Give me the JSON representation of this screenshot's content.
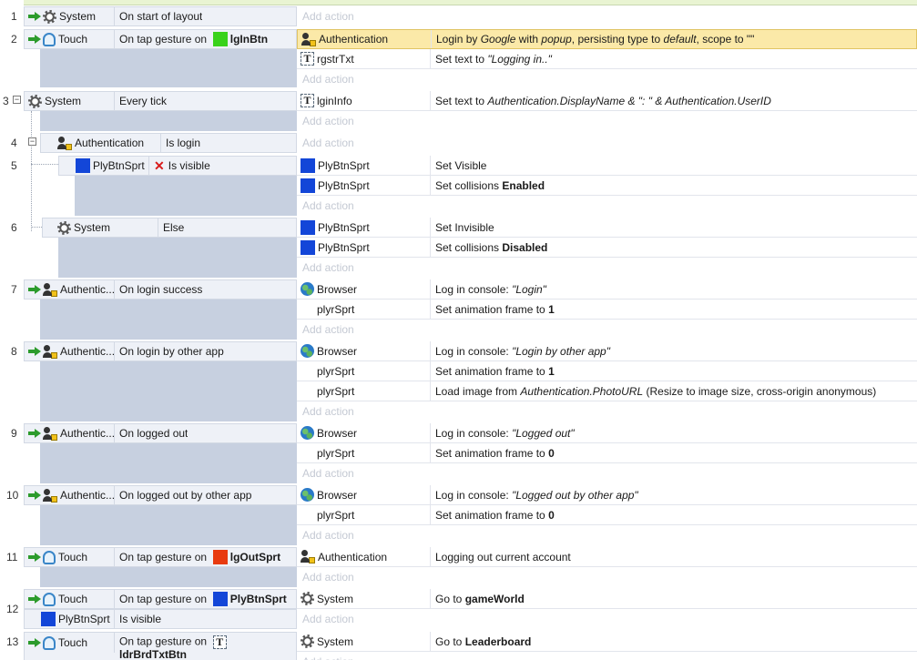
{
  "group_header": "",
  "events": [
    {
      "num": "1",
      "cond_obj": "System",
      "cond": "On start of layout",
      "add": "Add action"
    },
    {
      "num": "2",
      "cond_obj": "Touch",
      "cond_pre": "On tap gesture on",
      "cond_target": "lgInBtn",
      "actions": [
        {
          "obj": "Authentication",
          "pre": "Login by ",
          "i1": "Google",
          "m1": " with ",
          "i2": "popup",
          "m2": ", persisting type to ",
          "i3": "default",
          "m3": ", scope to \"\""
        },
        {
          "obj": "rgstrTxt",
          "pre": "Set text to ",
          "i1": "\"Logging in..\""
        }
      ],
      "add": "Add action"
    },
    {
      "num": "3",
      "cond_obj": "System",
      "cond": "Every tick",
      "actions": [
        {
          "obj": "lginInfo",
          "pre": "Set text to ",
          "i1": "Authentication.DisplayName & \": \" & Authentication.UserID"
        }
      ],
      "add": "Add action"
    },
    {
      "num": "4",
      "cond_obj": "Authentication",
      "cond": "Is login",
      "add": "Add action"
    },
    {
      "num": "5",
      "cond_obj": "PlyBtnSprt",
      "cond": "Is visible",
      "actions": [
        {
          "obj": "PlyBtnSprt",
          "text": "Set Visible"
        },
        {
          "obj": "PlyBtnSprt",
          "pre": "Set collisions ",
          "bold": "Enabled"
        }
      ],
      "add": "Add action"
    },
    {
      "num": "6",
      "cond_obj": "System",
      "cond": "Else",
      "actions": [
        {
          "obj": "PlyBtnSprt",
          "text": "Set Invisible"
        },
        {
          "obj": "PlyBtnSprt",
          "pre": "Set collisions ",
          "bold": "Disabled"
        }
      ],
      "add": "Add action"
    },
    {
      "num": "7",
      "cond_obj": "Authentic...",
      "cond": "On login success",
      "actions": [
        {
          "obj": "Browser",
          "pre": "Log in console: ",
          "i1": "\"Login\""
        },
        {
          "obj": "plyrSprt",
          "pre": "Set animation frame to ",
          "bold": "1"
        }
      ],
      "add": "Add action"
    },
    {
      "num": "8",
      "cond_obj": "Authentic...",
      "cond": "On login by other app",
      "actions": [
        {
          "obj": "Browser",
          "pre": "Log in console: ",
          "i1": "\"Login by other app\""
        },
        {
          "obj": "plyrSprt",
          "pre": "Set animation frame to ",
          "bold": "1"
        },
        {
          "obj": "plyrSprt",
          "pre": "Load image from ",
          "i1": "Authentication.PhotoURL",
          "post": "  (Resize to image size, cross-origin anonymous)"
        }
      ],
      "add": "Add action"
    },
    {
      "num": "9",
      "cond_obj": "Authentic...",
      "cond": "On logged out",
      "actions": [
        {
          "obj": "Browser",
          "pre": "Log in console: ",
          "i1": "\"Logged out\""
        },
        {
          "obj": "plyrSprt",
          "pre": "Set animation frame to ",
          "bold": "0"
        }
      ],
      "add": "Add action"
    },
    {
      "num": "10",
      "cond_obj": "Authentic...",
      "cond": "On logged out by other app",
      "actions": [
        {
          "obj": "Browser",
          "pre": "Log in console: ",
          "i1": "\"Logged out by other app\""
        },
        {
          "obj": "plyrSprt",
          "pre": "Set animation frame to ",
          "bold": "0"
        }
      ],
      "add": "Add action"
    },
    {
      "num": "11",
      "cond_obj": "Touch",
      "cond_pre": "On tap gesture on",
      "cond_target": "lgOutSprt",
      "actions": [
        {
          "obj": "Authentication",
          "text": "Logging out current account"
        }
      ],
      "add": "Add action"
    },
    {
      "num": "12",
      "cond_obj": "Touch",
      "cond_pre": "On tap gesture on",
      "cond_target": "PlyBtnSprt",
      "cond2_obj": "PlyBtnSprt",
      "cond2": "Is visible",
      "actions": [
        {
          "obj": "System",
          "pre": "Go to ",
          "bold": "gameWorld"
        }
      ],
      "add": "Add action"
    },
    {
      "num": "13",
      "cond_obj": "Touch",
      "cond_pre": "On tap gesture on",
      "cond_target": "ldrBrdTxtBtn",
      "actions": [
        {
          "obj": "System",
          "pre": "Go to ",
          "bold": "Leaderboard"
        }
      ],
      "add": "Add action"
    }
  ]
}
